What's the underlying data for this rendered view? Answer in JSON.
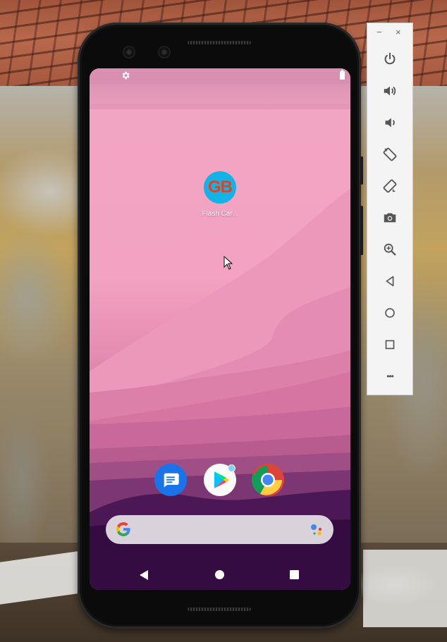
{
  "window": {
    "toolbar": {
      "minimize_label": "−",
      "close_label": "×",
      "more_label": "•••",
      "buttons": [
        "power-icon",
        "volume-up-icon",
        "volume-down-icon",
        "rotate-left-icon",
        "rotate-right-icon",
        "camera-icon",
        "zoom-icon",
        "back-icon",
        "home-icon",
        "overview-icon",
        "more-icon"
      ]
    }
  },
  "phone": {
    "home": {
      "apps": [
        {
          "icon_text": "GB",
          "label": "Flash Car..."
        }
      ],
      "dock": [
        "messages-icon",
        "play-store-icon",
        "chrome-icon"
      ]
    },
    "colors": {
      "wallpaper_top": "#f3a2c1",
      "wallpaper_bottom": "#300a3d",
      "app_icon_bg": "#12b3e8",
      "app_icon_text": "#e8401c",
      "search_bar": "#d9d2db"
    }
  }
}
